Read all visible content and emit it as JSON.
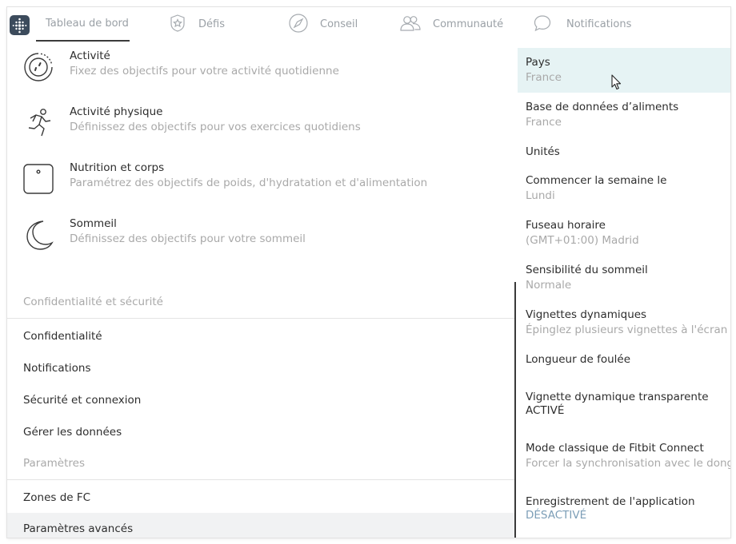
{
  "nav": {
    "items": [
      {
        "label": "Tableau de bord",
        "icon": "fitbit-logo-icon"
      },
      {
        "label": "Défis",
        "icon": "star-badge-icon"
      },
      {
        "label": "Conseil",
        "icon": "compass-icon"
      },
      {
        "label": "Communauté",
        "icon": "people-icon"
      },
      {
        "label": "Notifications",
        "icon": "chat-bubble-icon"
      }
    ]
  },
  "goals": [
    {
      "title": "Activité",
      "desc": "Fixez des objectifs pour votre activité quotidienne",
      "icon": "activity-dial-icon"
    },
    {
      "title": "Activité physique",
      "desc": "Définissez des objectifs pour vos exercices quotidiens",
      "icon": "running-person-icon"
    },
    {
      "title": "Nutrition et corps",
      "desc": "Paramétrez des objectifs de poids, d'hydratation et d'alimentation",
      "icon": "scale-icon"
    },
    {
      "title": "Sommeil",
      "desc": "Définissez des objectifs pour votre sommeil",
      "icon": "moon-icon"
    }
  ],
  "privacy": {
    "header": "Confidentialité et sécurité",
    "items": [
      "Confidentialité",
      "Notifications",
      "Sécurité et connexion",
      "Gérer les données"
    ]
  },
  "params": {
    "header": "Paramètres",
    "items": [
      "Zones de FC",
      "Paramètres avancés"
    ]
  },
  "advanced": [
    {
      "label": "Pays",
      "value": "France"
    },
    {
      "label": "Base de données d’aliments",
      "value": "France"
    },
    {
      "label": "Unités",
      "value": ""
    },
    {
      "label": "Commencer la semaine le",
      "value": "Lundi"
    },
    {
      "label": "Fuseau horaire",
      "value": "(GMT+01:00) Madrid"
    },
    {
      "label": "Sensibilité du sommeil",
      "value": "Normale"
    },
    {
      "label": "Vignettes dynamiques",
      "value": "Épinglez plusieurs vignettes à l'écran de"
    },
    {
      "label": "Longueur de foulée",
      "value": ""
    },
    {
      "label": "Vignette dynamique transparente",
      "value": "ACTIVÉ"
    },
    {
      "label": "Mode classique de Fitbit Connect",
      "value": "Forcer la synchronisation avec le dongle"
    },
    {
      "label": "Enregistrement de l'application",
      "value": "DÉSACTIVÉ"
    }
  ],
  "colors": {
    "accent_highlight": "#e6f3f4",
    "off_value": "#7c9eb7",
    "logo_bg": "#3c4b5c"
  }
}
